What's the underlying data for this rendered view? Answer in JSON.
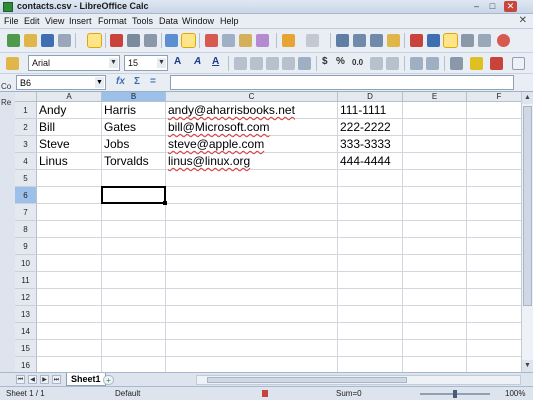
{
  "window": {
    "title": "contacts.csv - LibreOffice Calc",
    "min": "–",
    "max": "□",
    "close": "✕"
  },
  "menu": [
    "File",
    "Edit",
    "View",
    "Insert",
    "Format",
    "Tools",
    "Data",
    "Window",
    "Help"
  ],
  "doc_close": "✕",
  "formatting": {
    "font_name": "Arial",
    "font_size": "15"
  },
  "formula_bar": {
    "cell_ref": "B6",
    "fx": "fx",
    "sum": "Σ",
    "equals": "=",
    "content": ""
  },
  "side_strip": [
    "Co",
    "Re"
  ],
  "columns": [
    "A",
    "B",
    "C",
    "D",
    "E",
    "F"
  ],
  "rows": [
    "1",
    "2",
    "3",
    "4",
    "5",
    "6",
    "7",
    "8",
    "9",
    "10",
    "11",
    "12",
    "13",
    "14",
    "15",
    "16"
  ],
  "selected": {
    "column": "B",
    "row": "6"
  },
  "cells": [
    [
      "Andy",
      "Harris",
      "andy@aharrisbooks.net",
      "111-1111"
    ],
    [
      "Bill",
      "Gates",
      "bill@Microsoft.com",
      "222-2222"
    ],
    [
      "Steve",
      "Jobs",
      "steve@apple.com",
      "333-3333"
    ],
    [
      "Linus",
      "Torvalds",
      "linus@linux.org",
      "444-4444"
    ]
  ],
  "sheet_tabs": [
    "Sheet1"
  ],
  "status": {
    "sheet": "Sheet 1 / 1",
    "style": "Default",
    "sum": "Sum=0",
    "zoom": "100%",
    "zoom_level": 1.0
  },
  "colors": {
    "selected_header": "#9bc0ea",
    "spell_underline": "#d33",
    "title_bg": "#dfe8f3"
  }
}
